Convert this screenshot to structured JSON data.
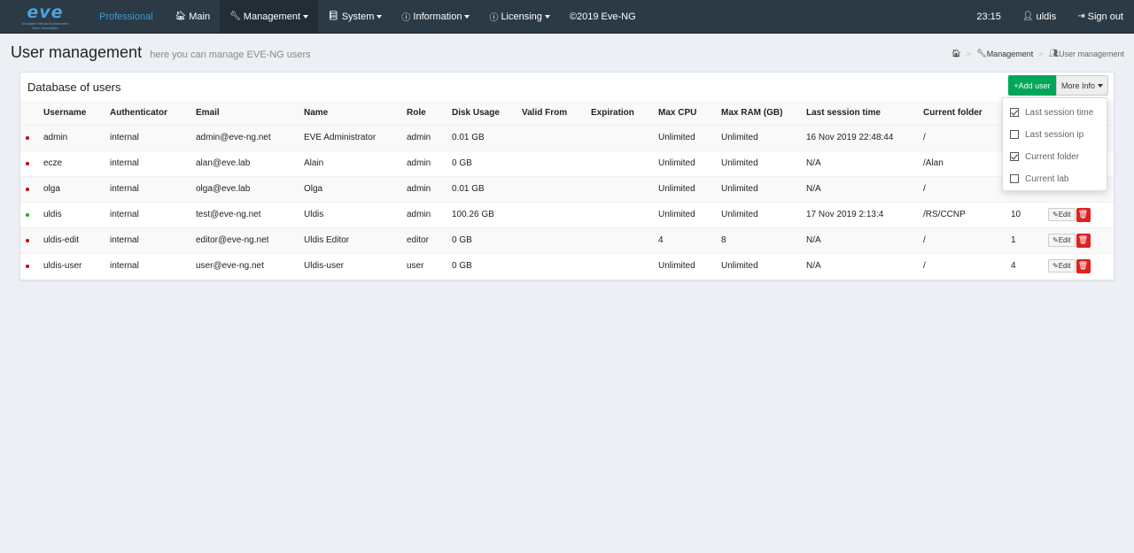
{
  "nav": {
    "logo_big": "eve",
    "logo_small": "Emulated Virtual Environment",
    "logo_small2": "Next Generation",
    "brand": "Professional",
    "main": "Main",
    "management": "Management",
    "system": "System",
    "information": "Information",
    "licensing": "Licensing",
    "copyright": "©2019 Eve-NG",
    "time": "23:15",
    "user": "uldis",
    "signout": "Sign out"
  },
  "header": {
    "title": "User management",
    "subtitle": "here you can manage EVE-NG users"
  },
  "breadcrumb": {
    "management": "Management",
    "current": "User management"
  },
  "panel": {
    "title": "Database of users",
    "add_user": "+Add user",
    "more_info": "More Info"
  },
  "table": {
    "headers": [
      "Username",
      "Authenticator",
      "Email",
      "Name",
      "Role",
      "Disk Usage",
      "Valid From",
      "Expiration",
      "Max CPU",
      "Max RAM (GB)",
      "Last session time",
      "Current folder"
    ],
    "rows": [
      {
        "status": "#cc0000",
        "username": "admin",
        "auth": "internal",
        "email": "admin@eve-ng.net",
        "name": "EVE Administrator",
        "role": "admin",
        "disk": "0.01 GB",
        "valid_from": "",
        "expiration": "",
        "cpu": "Unlimited",
        "ram": "Unlimited",
        "last_session": "16 Nov 2019 22:48:44",
        "folder": "/",
        "count": ""
      },
      {
        "status": "#cc0000",
        "username": "ecze",
        "auth": "internal",
        "email": "alan@eve.lab",
        "name": "Alain",
        "role": "admin",
        "disk": "0 GB",
        "valid_from": "",
        "expiration": "",
        "cpu": "Unlimited",
        "ram": "Unlimited",
        "last_session": "N/A",
        "folder": "/Alan",
        "count": ""
      },
      {
        "status": "#cc0000",
        "username": "olga",
        "auth": "internal",
        "email": "olga@eve.lab",
        "name": "Olga",
        "role": "admin",
        "disk": "0.01 GB",
        "valid_from": "",
        "expiration": "",
        "cpu": "Unlimited",
        "ram": "Unlimited",
        "last_session": "N/A",
        "folder": "/",
        "count": ""
      },
      {
        "status": "#22aa22",
        "username": "uldis",
        "auth": "internal",
        "email": "test@eve-ng.net",
        "name": "Uldis",
        "role": "admin",
        "disk": "100.26 GB",
        "valid_from": "",
        "expiration": "",
        "cpu": "Unlimited",
        "ram": "Unlimited",
        "last_session": "17 Nov 2019 2:13:4",
        "folder": "/RS/CCNP",
        "count": "10"
      },
      {
        "status": "#cc0000",
        "username": "uldis-edit",
        "auth": "internal",
        "email": "editor@eve-ng.net",
        "name": "Uldis Editor",
        "role": "editor",
        "disk": "0 GB",
        "valid_from": "",
        "expiration": "",
        "cpu": "4",
        "ram": "8",
        "last_session": "N/A",
        "folder": "/",
        "count": "1"
      },
      {
        "status": "#cc0000",
        "username": "uldis-user",
        "auth": "internal",
        "email": "user@eve-ng.net",
        "name": "Uldis-user",
        "role": "user",
        "disk": "0 GB",
        "valid_from": "",
        "expiration": "",
        "cpu": "Unlimited",
        "ram": "Unlimited",
        "last_session": "N/A",
        "folder": "/",
        "count": "4"
      }
    ],
    "edit_label": "Edit"
  },
  "more_info_menu": [
    {
      "label": "Last session time",
      "checked": true
    },
    {
      "label": "Last session ip",
      "checked": false
    },
    {
      "label": "Current folder",
      "checked": true
    },
    {
      "label": "Current lab",
      "checked": false
    }
  ],
  "icons": [
    "home-icon",
    "wrench-icon",
    "book-icon",
    "info-icon",
    "user-icon",
    "signout-icon",
    "users-icon",
    "edit-icon",
    "trash-icon"
  ]
}
